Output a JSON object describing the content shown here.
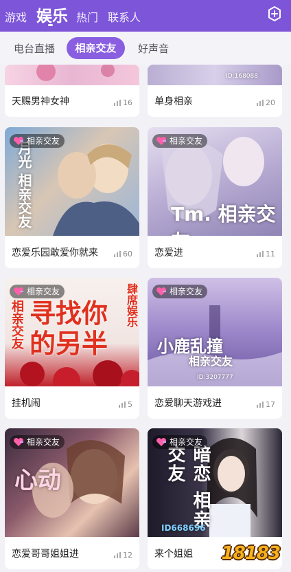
{
  "header": {
    "tabs": [
      {
        "label": "游戏"
      },
      {
        "label": "娱乐"
      },
      {
        "label": "热门"
      },
      {
        "label": "联系人"
      }
    ],
    "active_tab": "娱乐",
    "add_icon": "add-square-icon"
  },
  "subtabs": {
    "items": [
      {
        "label": "电台直播"
      },
      {
        "label": "相亲交友"
      },
      {
        "label": "好声音"
      }
    ],
    "active": "相亲交友"
  },
  "colors": {
    "accent": "#7d55d8",
    "active_pill": "#8a5ee0",
    "watermark": "#f6b21d"
  },
  "rooms": [
    {
      "title": "天赐男神女神",
      "listeners": "16",
      "art_text": ""
    },
    {
      "title": "单身相亲",
      "listeners": "20",
      "art_text": "ID:168088"
    },
    {
      "title": "恋爱乐园敢爱你就来",
      "listeners": "60",
      "badge": "相亲交友",
      "art_text": "月光 相亲交友"
    },
    {
      "title": "恋爱进",
      "listeners": "11",
      "badge": "相亲交友",
      "art_text": "Tm. 相亲交友"
    },
    {
      "title": "挂机闹",
      "listeners": "5",
      "badge": "相亲交友",
      "art_text": "寻找你的另半",
      "art_side": "相亲交友",
      "art_side2": "肆席娱乐"
    },
    {
      "title": "恋爱聊天游戏进",
      "listeners": "17",
      "badge": "相亲交友",
      "art_text": "小鹿乱撞",
      "art_sub": "相亲交友",
      "art_id": "ID:3207777"
    },
    {
      "title": "恋爱哥哥姐姐进",
      "listeners": "12",
      "badge": "相亲交友",
      "art_text": "心动"
    },
    {
      "title": "来个姐姐",
      "listeners": "",
      "badge": "相亲交友",
      "art_text": "暗恋 相亲交友",
      "art_id": "ID668696"
    }
  ],
  "watermark": "18183"
}
